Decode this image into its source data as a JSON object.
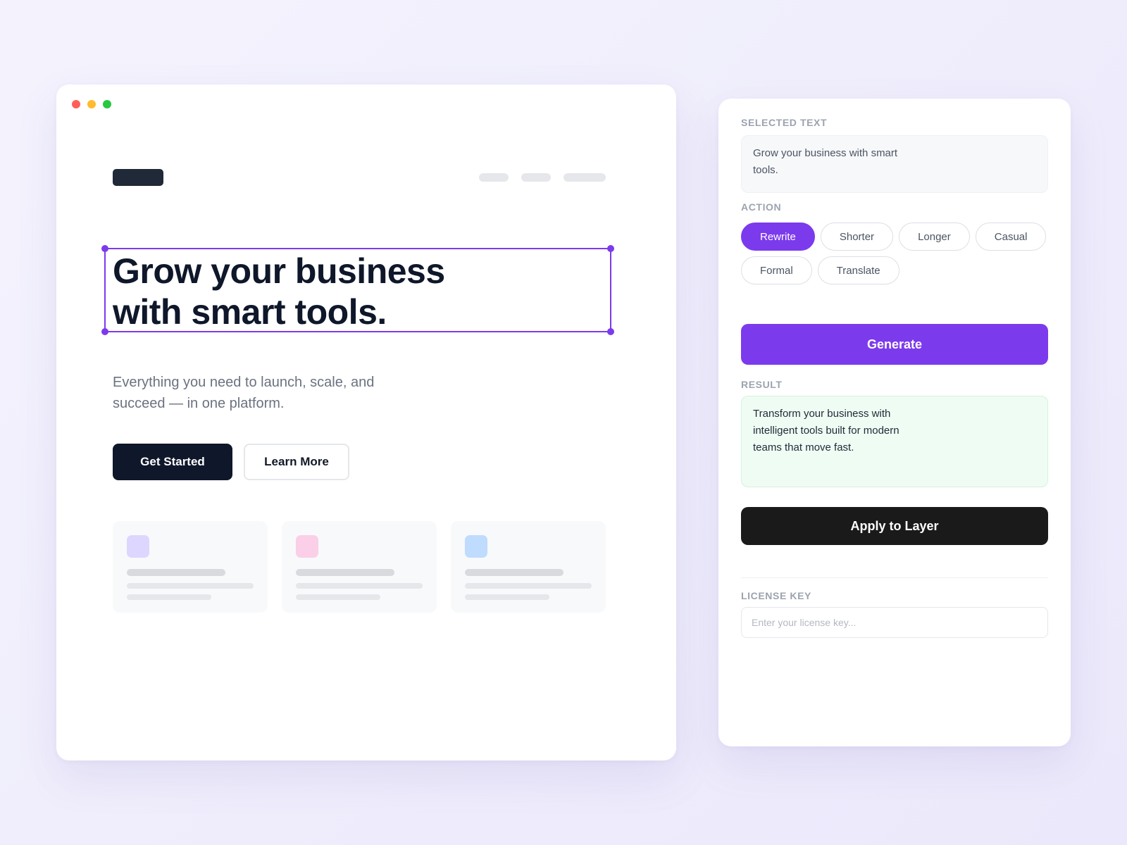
{
  "canvas": {
    "hero": {
      "title": "Grow your business with smart tools.",
      "subtitle": "Everything you need to launch, scale, and succeed — in one platform."
    },
    "buttons": {
      "primary_label": "Get Started",
      "secondary_label": "Learn More"
    },
    "feature_cards": [
      {
        "icon_color": "#ddd6fe"
      },
      {
        "icon_color": "#fbcfe8"
      },
      {
        "icon_color": "#bfdbfe"
      }
    ]
  },
  "panel": {
    "selected_text": {
      "label": "SELECTED TEXT",
      "value": "Grow your business with smart tools."
    },
    "action": {
      "label": "ACTION",
      "options": [
        "Rewrite",
        "Shorter",
        "Longer",
        "Casual",
        "Formal",
        "Translate"
      ],
      "selected": "Rewrite"
    },
    "generate_label": "Generate",
    "result": {
      "label": "RESULT",
      "value": "Transform your business with intelligent tools built for modern teams that move fast."
    },
    "apply_label": "Apply to Layer",
    "license": {
      "label": "LICENSE KEY",
      "placeholder": "Enter your license key...",
      "value": ""
    }
  },
  "colors": {
    "accent": "#7c3aed",
    "dark": "#0f172a",
    "result_bg": "#effcf3"
  }
}
